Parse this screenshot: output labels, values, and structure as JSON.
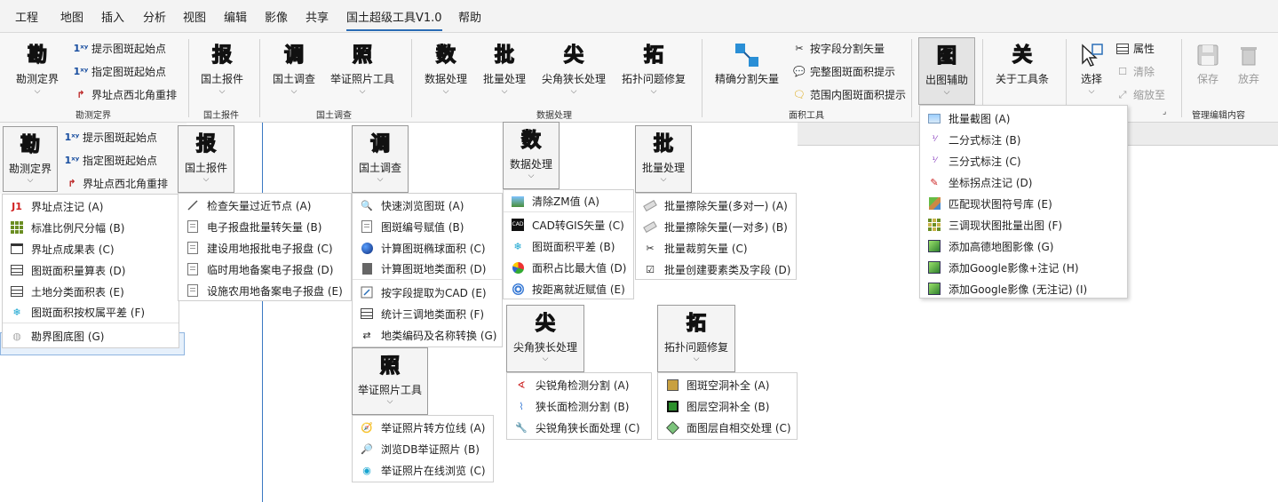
{
  "menubar": [
    "工程",
    "地图",
    "插入",
    "分析",
    "视图",
    "编辑",
    "影像",
    "共享",
    "国土超级工具V1.0",
    "帮助"
  ],
  "ribbon": {
    "kance": {
      "big": "勘测定界",
      "small": [
        "提示图斑起始点",
        "指定图斑起始点",
        "界址点西北角重排"
      ],
      "group": "勘测定界"
    },
    "baojian": {
      "big": "国土报件",
      "group": "国土报件"
    },
    "diaocha": {
      "big1": "国土调查",
      "big2": "举证照片工具",
      "group": "国土调查"
    },
    "shuju": {
      "b1": "数据处理",
      "b2": "批量处理",
      "b3": "尖角狭长处理",
      "b4": "拓扑问题修复",
      "group": "数据处理"
    },
    "mianji": {
      "big": "精确分割矢量",
      "small": [
        "按字段分割矢量",
        "完整图斑面积提示",
        "范围内图斑面积提示"
      ],
      "group": "面积工具"
    },
    "chutu": {
      "big": "出图辅助"
    },
    "about": {
      "big": "关于工具条"
    },
    "select": {
      "big": "选择",
      "small": [
        "属性",
        "清除",
        "缩放至"
      ]
    },
    "edit": {
      "save": "保存",
      "discard": "放弃",
      "group": "管理编辑内容"
    }
  },
  "seals": {
    "kan": "勘",
    "bao": "报",
    "diao": "调",
    "zhao": "照",
    "shu": "数",
    "pi": "批",
    "jian": "尖",
    "tuo": "拓",
    "guan": "关",
    "chu": "图"
  },
  "popups": {
    "kance": {
      "title": "勘测定界",
      "small": [
        "提示图斑起始点",
        "指定图斑起始点",
        "界址点西北角重排"
      ],
      "items": [
        "界址点注记 (A)",
        "标准比例尺分幅 (B)",
        "界址点成果表 (C)",
        "图斑面积量算表 (D)",
        "土地分类面积表 (E)",
        "图斑面积按权属平差 (F)",
        "勘界图底图 (G)"
      ]
    },
    "baojian": {
      "title": "国土报件",
      "items": [
        "检查矢量过近节点 (A)",
        "电子报盘批量转矢量 (B)",
        "建设用地报批电子报盘 (C)",
        "临时用地备案电子报盘 (D)",
        "设施农用地备案电子报盘 (E)"
      ]
    },
    "diaocha": {
      "title": "国土调查",
      "items": [
        "快速浏览图斑 (A)",
        "图斑编号赋值 (B)",
        "计算图斑椭球面积 (C)",
        "计算图斑地类面积 (D)",
        "按字段提取为CAD (E)",
        "统计三调地类面积 (F)",
        "地类编码及名称转换 (G)"
      ]
    },
    "zhaopian": {
      "title": "举证照片工具",
      "items": [
        "举证照片转方位线 (A)",
        "浏览DB举证照片 (B)",
        "举证照片在线浏览 (C)"
      ]
    },
    "shuju": {
      "title": "数据处理",
      "items": [
        "清除ZM值 (A)",
        "CAD转GIS矢量 (C)",
        "图斑面积平差 (B)",
        "面积占比最大值 (D)",
        "按距离就近赋值 (E)"
      ]
    },
    "pichuli": {
      "title": "批量处理",
      "items": [
        "批量擦除矢量(多对一) (A)",
        "批量擦除矢量(一对多) (B)",
        "批量裁剪矢量 (C)",
        "批量创建要素类及字段 (D)"
      ]
    },
    "jianjiao": {
      "title": "尖角狭长处理",
      "items": [
        "尖锐角检测分割 (A)",
        "狭长面检测分割 (B)",
        "尖锐角狭长面处理 (C)"
      ]
    },
    "tuopu": {
      "title": "拓扑问题修复",
      "items": [
        "图斑空洞补全 (A)",
        "图层空洞补全 (B)",
        "面图层自相交处理 (C)"
      ]
    },
    "chutu": {
      "items": [
        "批量截图 (A)",
        "二分式标注 (B)",
        "三分式标注 (C)",
        "坐标拐点注记 (D)",
        "匹配现状图符号库 (E)",
        "三调现状图批量出图 (F)",
        "添加高德地图影像 (G)",
        "添加Google影像+注记 (H)",
        "添加Google影像 (无注记) (I)"
      ]
    }
  }
}
